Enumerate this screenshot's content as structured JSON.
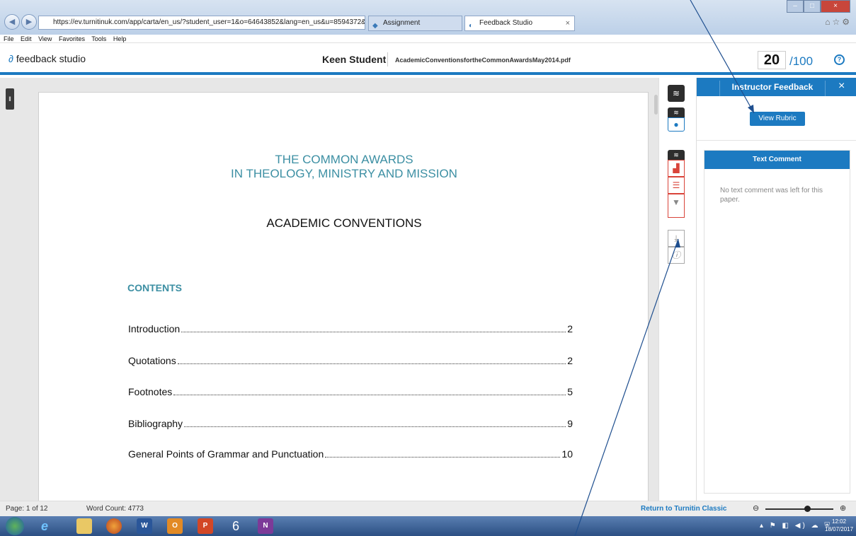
{
  "browser": {
    "url": "https://ev.turnitinuk.com/app/carta/en_us/?student_user=1&o=64643852&lang=en_us&u=8594372&s=",
    "tabs": [
      {
        "label": "Assignment"
      },
      {
        "label": "Feedback Studio"
      }
    ],
    "menu": [
      "File",
      "Edit",
      "View",
      "Favorites",
      "Tools",
      "Help"
    ]
  },
  "header": {
    "logo_text": "feedback studio",
    "student_name": "Keen Student",
    "file_name": "AcademicConventionsfortheCommonAwardsMay2014.pdf",
    "score": "20",
    "score_max": "/100",
    "help": "?"
  },
  "document": {
    "title_line1": "THE COMMON AWARDS",
    "title_line2": "IN THEOLOGY, MINISTRY AND MISSION",
    "subtitle": "ACADEMIC CONVENTIONS",
    "contents_heading": "CONTENTS",
    "toc": [
      {
        "label": "Introduction",
        "page": "2"
      },
      {
        "label": "Quotations",
        "page": "2"
      },
      {
        "label": "Footnotes",
        "page": "5"
      },
      {
        "label": "Bibliography",
        "page": "9"
      },
      {
        "label": "General Points of Grammar and Punctuation",
        "page": "10"
      }
    ]
  },
  "panel": {
    "title": "Instructor Feedback",
    "rubric_button": "View Rubric",
    "text_comment_header": "Text Comment",
    "text_comment_body": "No text comment was left for this paper."
  },
  "status": {
    "page": "Page: 1 of 12",
    "word_count": "Word Count: 4773",
    "return_link": "Return to Turnitin Classic"
  },
  "taskbar": {
    "time": "12:02",
    "date": "18/07/2017"
  },
  "colors": {
    "accent": "#1c7ac1",
    "title_teal": "#3c8fa3",
    "tool_red": "#d9443a"
  }
}
